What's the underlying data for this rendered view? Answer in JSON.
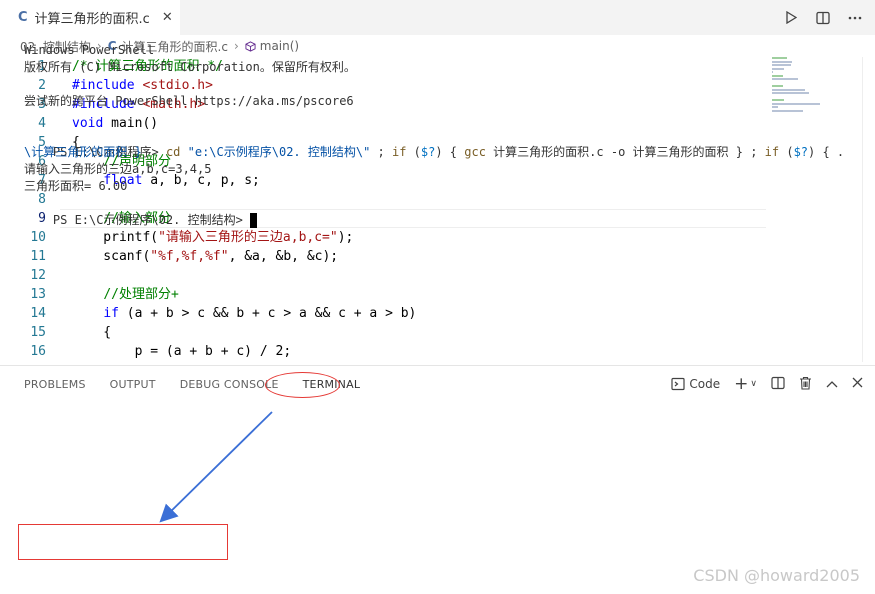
{
  "tab": {
    "icon": "C",
    "title": "计算三角形的面积.c",
    "close": "✕"
  },
  "editor_actions": [
    {
      "name": "run-icon"
    },
    {
      "name": "split-editor-icon"
    },
    {
      "name": "more-icon"
    }
  ],
  "breadcrumb": {
    "folder": "02. 控制结构",
    "file": "计算三角形的面积.c",
    "symbol": "main()"
  },
  "code_lines": [
    {
      "n": "1",
      "parts": [
        [
          "cm",
          "/* 计算三角形的面积 */"
        ]
      ]
    },
    {
      "n": "2",
      "parts": [
        [
          "pp",
          "#include "
        ],
        [
          "inc",
          "<stdio.h>"
        ]
      ]
    },
    {
      "n": "3",
      "parts": [
        [
          "pp",
          "#include "
        ],
        [
          "inc",
          "<math.h>"
        ]
      ]
    },
    {
      "n": "4",
      "parts": [
        [
          "kw",
          "void"
        ],
        [
          "",
          " main()"
        ]
      ]
    },
    {
      "n": "5",
      "parts": [
        [
          "",
          "{"
        ]
      ]
    },
    {
      "n": "6",
      "parts": [
        [
          "",
          "    "
        ],
        [
          "cm",
          "//声明部分"
        ]
      ]
    },
    {
      "n": "7",
      "parts": [
        [
          "",
          "    "
        ],
        [
          "kw",
          "float"
        ],
        [
          "",
          " a, b, c, p, s;"
        ]
      ]
    },
    {
      "n": "8",
      "parts": [
        [
          "",
          ""
        ]
      ]
    },
    {
      "n": "9",
      "parts": [
        [
          "",
          "    "
        ],
        [
          "cm",
          "//输入部分"
        ]
      ]
    },
    {
      "n": "10",
      "parts": [
        [
          "",
          "    printf("
        ],
        [
          "str",
          "\"请输入三角形的三边a,b,c=\""
        ],
        [
          "",
          ");"
        ]
      ]
    },
    {
      "n": "11",
      "parts": [
        [
          "",
          "    scanf("
        ],
        [
          "str",
          "\"%f,%f,%f\""
        ],
        [
          "",
          ", &a, &b, &c);"
        ]
      ]
    },
    {
      "n": "12",
      "parts": [
        [
          "",
          ""
        ]
      ]
    },
    {
      "n": "13",
      "parts": [
        [
          "",
          "    "
        ],
        [
          "cm",
          "//处理部分+"
        ]
      ]
    },
    {
      "n": "14",
      "parts": [
        [
          "",
          "    "
        ],
        [
          "kw",
          "if"
        ],
        [
          "",
          " (a + b > c && b + c > a && c + a > b)"
        ]
      ]
    },
    {
      "n": "15",
      "parts": [
        [
          "",
          "    {"
        ]
      ]
    },
    {
      "n": "16",
      "parts": [
        [
          "",
          "        p = (a + b + c) / 2;"
        ]
      ]
    }
  ],
  "current_line": "9",
  "panel": {
    "tabs": [
      "PROBLEMS",
      "OUTPUT",
      "DEBUG CONSOLE",
      "TERMINAL"
    ],
    "active_tab": "TERMINAL",
    "terminal_profile": "Code",
    "add": "+",
    "chevron": "∨"
  },
  "terminal": {
    "line1": "Windows PowerShell",
    "line2": "版权所有 (C) Microsoft Corporation。保留所有权利。",
    "line3": "尝试新的跨平台 PowerShell https://aka.ms/pscore6",
    "prompt": "PS E:\\C示例程序> ",
    "cmd_parts": [
      [
        "t-cmd",
        "cd"
      ],
      [
        "t-str",
        " \"e:\\C示例程序\\02. 控制结构\\\""
      ],
      [
        "t-op",
        " ; "
      ],
      [
        "t-cmd",
        "if"
      ],
      [
        "t-op",
        " ("
      ],
      [
        "t-var",
        "$?"
      ],
      [
        "t-op",
        ") { "
      ],
      [
        "t-cmd",
        "gcc"
      ],
      [
        "t-op",
        " 计算三角形的面积.c -o 计算三角形的面积 } ; "
      ],
      [
        "t-cmd",
        "if"
      ],
      [
        "t-op",
        " ("
      ],
      [
        "t-var",
        "$?"
      ],
      [
        "t-op",
        ") { ."
      ]
    ],
    "cmd_cont": "\\计算三角形的面积 }",
    "out1": "请输入三角形的三边a,b,c=3,4,5",
    "out2": "三角形面积= 6.00",
    "final_prompt": "PS E:\\C示例程序\\02. 控制结构> "
  },
  "watermark": "CSDN @howard2005"
}
